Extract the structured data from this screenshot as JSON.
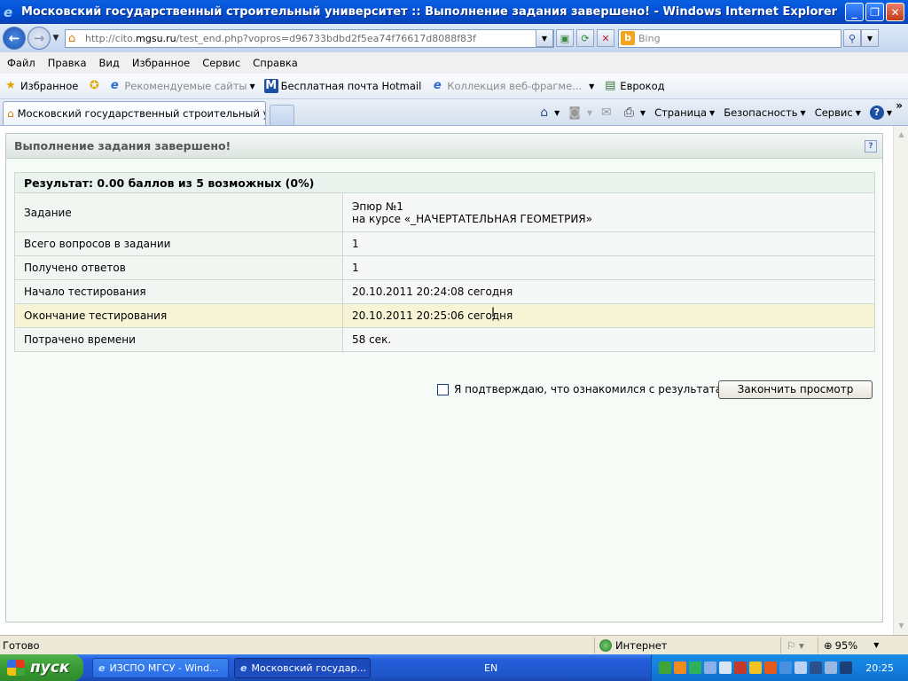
{
  "window": {
    "title": "Московский государственный строительный университет :: Выполнение задания завершено! - Windows Internet Explorer"
  },
  "address_bar": {
    "url_prefix": "http://cito.",
    "url_host": "mgsu.ru",
    "url_path": "/test_end.php?vopros=d96733bdbd2f5ea74f76617d8088f83f",
    "search_placeholder": "Bing"
  },
  "menu": {
    "items": [
      "Файл",
      "Правка",
      "Вид",
      "Избранное",
      "Сервис",
      "Справка"
    ]
  },
  "favorites_bar": {
    "favorites_label": "Избранное",
    "items": [
      "Рекомендуемые сайты",
      "Бесплатная почта Hotmail",
      "Коллекция веб-фрагме...",
      "Еврокод"
    ]
  },
  "tabs": {
    "active_tab_label": "Московский государственный строительный унив..."
  },
  "command_bar": {
    "page_label": "Страница",
    "safety_label": "Безопасность",
    "tools_label": "Сервис"
  },
  "panel": {
    "title": "Выполнение задания завершено!",
    "result_line": "Результат: 0.00 баллов из 5 возможных (0%)",
    "rows": [
      {
        "key": "Задание",
        "value": "Эпюр №1",
        "value2": "на курсе «_НАЧЕРТАТЕЛЬНАЯ ГЕОМЕТРИЯ»"
      },
      {
        "key": "Всего вопросов в задании",
        "value": "1"
      },
      {
        "key": "Получено ответов",
        "value": "1"
      },
      {
        "key": "Начало тестирования",
        "value": "20.10.2011 20:24:08 сегодня"
      },
      {
        "key": "Окончание тестирования",
        "value": "20.10.2011 20:25:06 сегодня"
      },
      {
        "key": "Потрачено времени",
        "value": "58 сек."
      }
    ],
    "confirm_label": "Я подтверждаю, что ознакомился с результатами",
    "finish_button": "Закончить просмотр"
  },
  "status_bar": {
    "status": "Готово",
    "zone": "Интернет",
    "zoom": "95%"
  },
  "taskbar": {
    "start_label": "пуск",
    "tasks": [
      "ИЗСПО МГСУ - Wind...",
      "Московский государ..."
    ],
    "language": "EN",
    "clock": "20:25"
  },
  "colors": {
    "title_bar": "#0453d8",
    "panel_bg": "#f7fbf8",
    "highlight_row": "#f7f4d5",
    "taskbar": "#245edb",
    "start_button": "#3a9b35"
  }
}
